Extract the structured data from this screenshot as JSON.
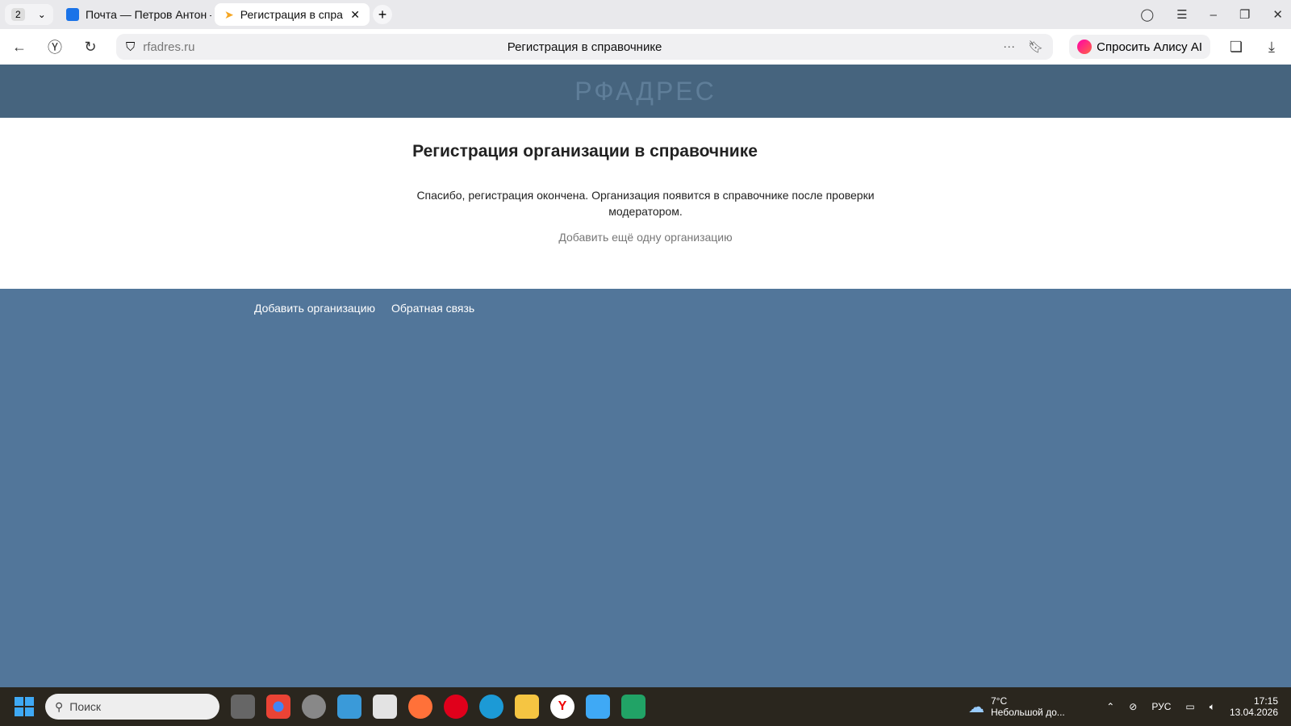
{
  "browser": {
    "tab_count": "2",
    "tabs": [
      {
        "title": "Почта — Петров Антон —"
      },
      {
        "title": "Регистрация в справочнике"
      }
    ],
    "url": "rfadres.ru",
    "page_title": "Регистрация в справочнике",
    "alisa_label": "Спросить Алису AI"
  },
  "site": {
    "logo": "РФАДРЕС",
    "heading": "Регистрация организации в справочнике",
    "message": "Спасибо, регистрация окончена. Организация появится в справочнике после проверки модератором.",
    "add_another": "Добавить ещё одну организацию",
    "footer_links": [
      "Добавить организацию",
      "Обратная связь"
    ]
  },
  "taskbar": {
    "search_placeholder": "Поиск",
    "weather_temp": "7°C",
    "weather_desc": "Небольшой до...",
    "lang": "РУС",
    "time": "17:15",
    "date": "13.04.2026"
  }
}
